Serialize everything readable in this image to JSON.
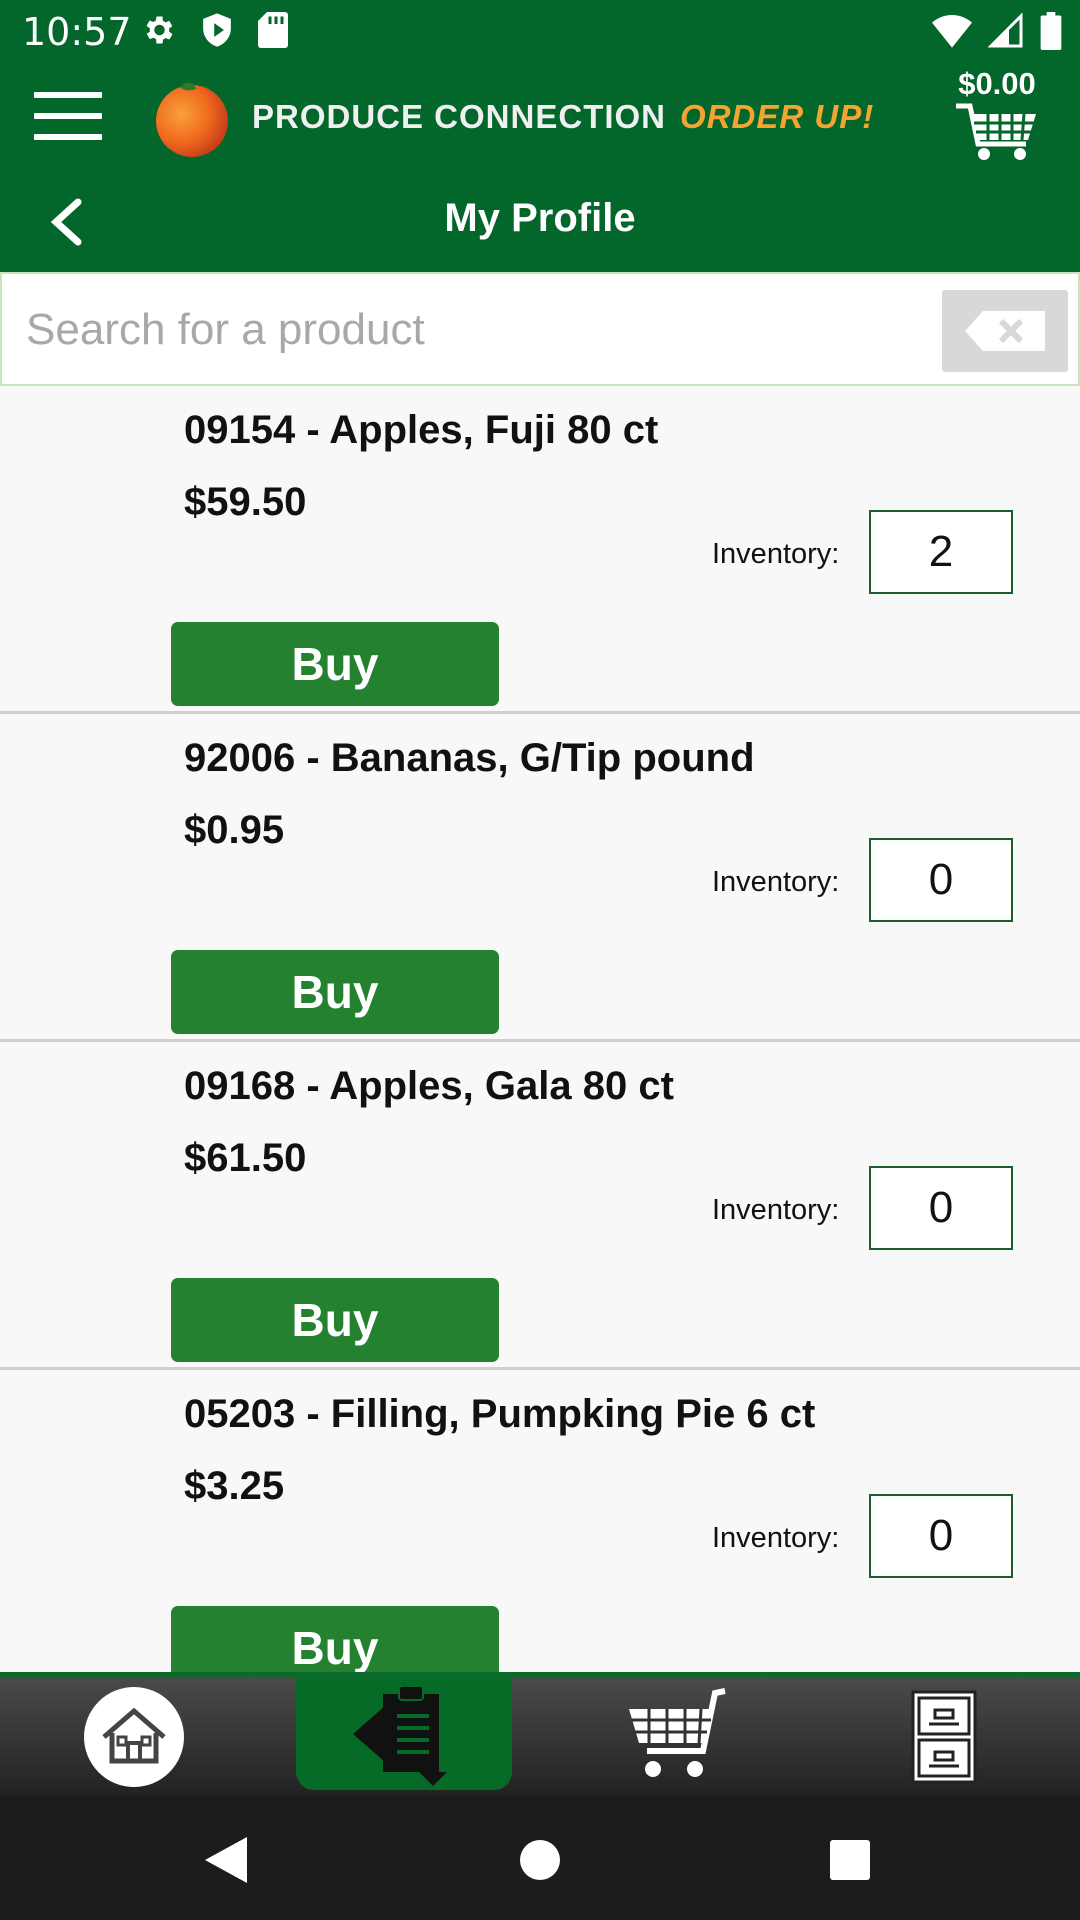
{
  "status_bar": {
    "time": "10:57",
    "left_icons": [
      "gear-icon",
      "shield-icon",
      "sd-card-icon"
    ],
    "right_icons": [
      "wifi-icon",
      "signal-icon",
      "battery-icon"
    ]
  },
  "header": {
    "logo_brand": "PRODUCE CONNECTION",
    "logo_tagline": "ORDER UP!",
    "cart_total": "$0.00",
    "colors": {
      "bar": "#03662a",
      "tagline": "#f5a432",
      "logo_fruit": "#f06a1e"
    }
  },
  "title_bar": {
    "title": "My Profile"
  },
  "search": {
    "placeholder": "Search for a product",
    "value": ""
  },
  "products": [
    {
      "name": "09154 - Apples, Fuji 80 ct",
      "price": "$59.50",
      "inventory_label": "Inventory:",
      "inventory": "2",
      "buy_label": "Buy"
    },
    {
      "name": "92006 - Bananas, G/Tip pound",
      "price": "$0.95",
      "inventory_label": "Inventory:",
      "inventory": "0",
      "buy_label": "Buy"
    },
    {
      "name": "09168 - Apples, Gala 80 ct",
      "price": "$61.50",
      "inventory_label": "Inventory:",
      "inventory": "0",
      "buy_label": "Buy"
    },
    {
      "name": "05203 - Filling, Pumpking Pie 6 ct",
      "price": "$3.25",
      "inventory_label": "Inventory:",
      "inventory": "0",
      "buy_label": "Buy"
    }
  ],
  "bottom_nav": {
    "items": [
      "home-icon",
      "order-guide-icon",
      "cart-icon",
      "file-cabinet-icon"
    ],
    "active": "order-guide-icon"
  },
  "system_nav": [
    "back-triangle-icon",
    "home-circle-icon",
    "recents-square-icon"
  ]
}
